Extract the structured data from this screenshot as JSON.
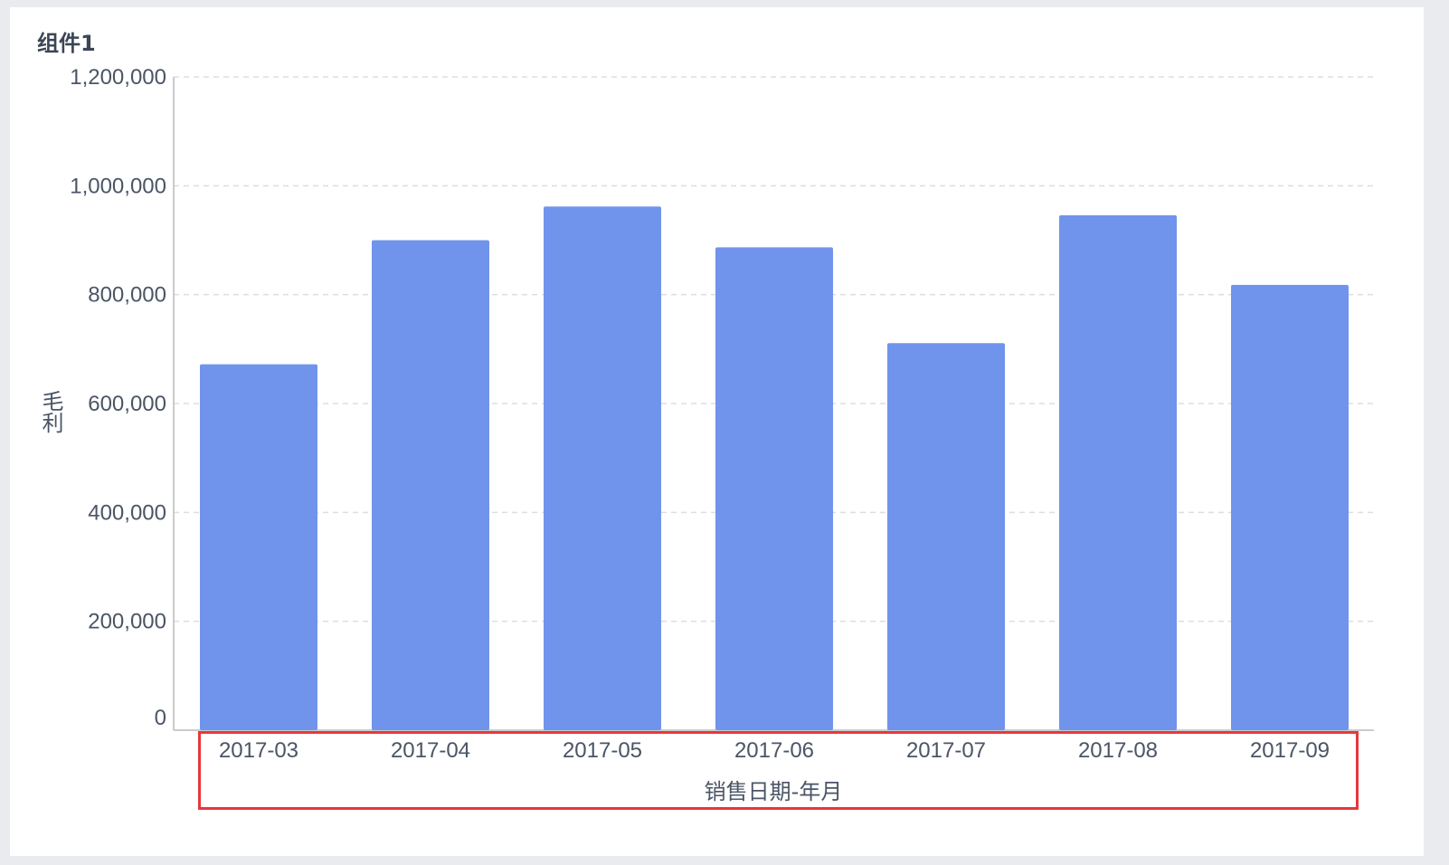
{
  "widget": {
    "title": "组件1"
  },
  "colors": {
    "bar": "#7094ec",
    "grid": "#dddddd",
    "axis": "#bbbbbb",
    "highlight": "#e8373b"
  },
  "chart_data": {
    "type": "bar",
    "categories": [
      "2017-03",
      "2017-04",
      "2017-05",
      "2017-06",
      "2017-07",
      "2017-08",
      "2017-09"
    ],
    "values": [
      672000,
      900000,
      962000,
      887000,
      711000,
      946000,
      818000
    ],
    "xlabel": "销售日期-年月",
    "ylabel": "毛利",
    "ylim": [
      0,
      1200000
    ],
    "yticks": [
      "0",
      "200,000",
      "400,000",
      "600,000",
      "800,000",
      "1,000,000",
      "1,200,000"
    ],
    "grid": true,
    "annotation": "x-axis region highlighted with red box"
  }
}
